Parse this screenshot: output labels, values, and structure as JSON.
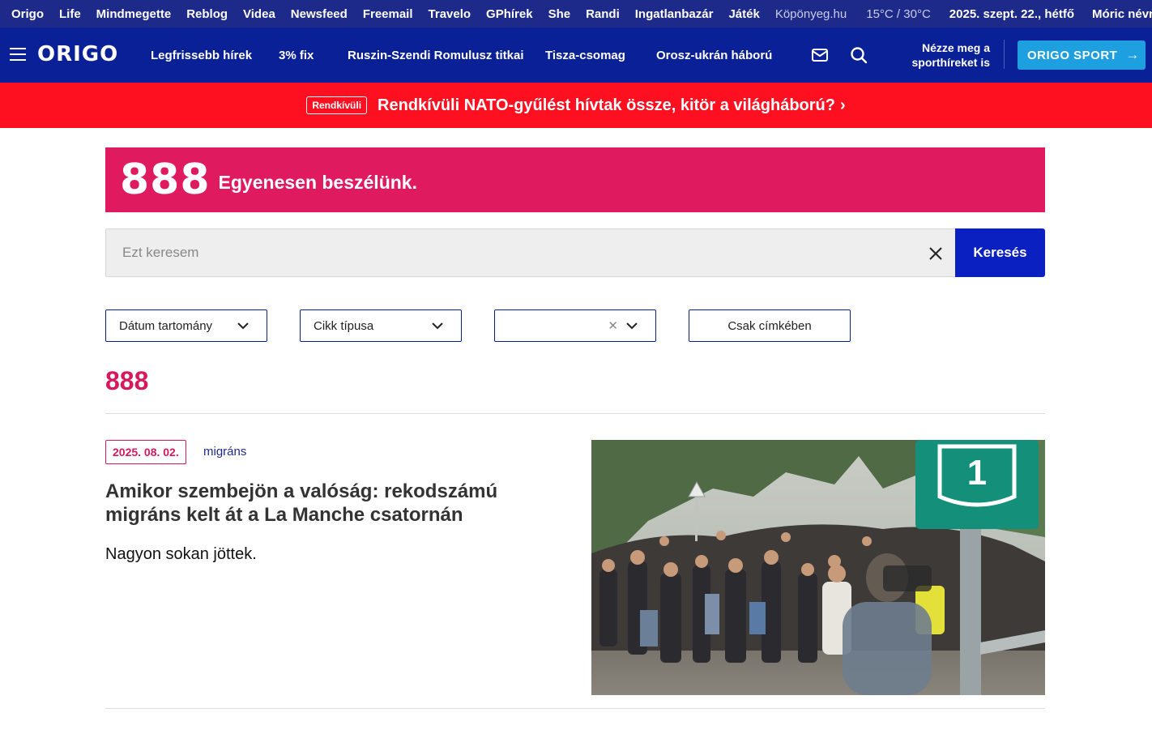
{
  "topbar": {
    "links": [
      "Origo",
      "Life",
      "Mindmegette",
      "Reblog",
      "Videa",
      "Newsfeed",
      "Freemail",
      "Travelo",
      "GPhírek",
      "She",
      "Randi",
      "Ingatlanbazár",
      "Játék"
    ],
    "koponyeg": "Köpönyeg.hu",
    "weather": "15°C / 30°C",
    "date": "2025. szept. 22., hétfő",
    "nameday": "Móric névnapja"
  },
  "header": {
    "logo": "ORIGO",
    "nav": [
      "Legfrissebb hírek",
      "3% fix",
      "Ruszin-Szendi Romulusz titkai",
      "Tisza-csomag",
      "Orosz-ukrán háború"
    ],
    "sport_cta": "Nézze meg a sporthíreket is",
    "sport_button": "ORIGO SPORT"
  },
  "breaking": {
    "tag": "Rendkívüli",
    "headline": "Rendkívüli NATO-gyűlést hívtak össze, kitör a világháború?"
  },
  "banner": {
    "number": "888",
    "slogan": "Egyenesen beszélünk."
  },
  "search": {
    "placeholder": "Ezt keresem",
    "value": "",
    "button": "Keresés"
  },
  "filters": {
    "date_range": "Dátum tartomány",
    "article_type": "Cikk típusa",
    "third": "",
    "tags_only": "Csak címkében"
  },
  "section_title": "888",
  "articles": [
    {
      "date": "2025. 08. 02.",
      "category": "migráns",
      "title": "Amikor szembejön a valóság: rekodszámú migráns kelt át a La Manche csatornán",
      "lead": "Nagyon sokan jöttek.",
      "sign_number": "1"
    }
  ],
  "colors": {
    "topbar": "#1e2a8a",
    "header": "#0a2096",
    "breaking": "#ff1020",
    "banner": "#e01a5f",
    "accent": "#d6195a",
    "search_button": "#0a20c0",
    "sport_button": "#1e9fe0"
  }
}
